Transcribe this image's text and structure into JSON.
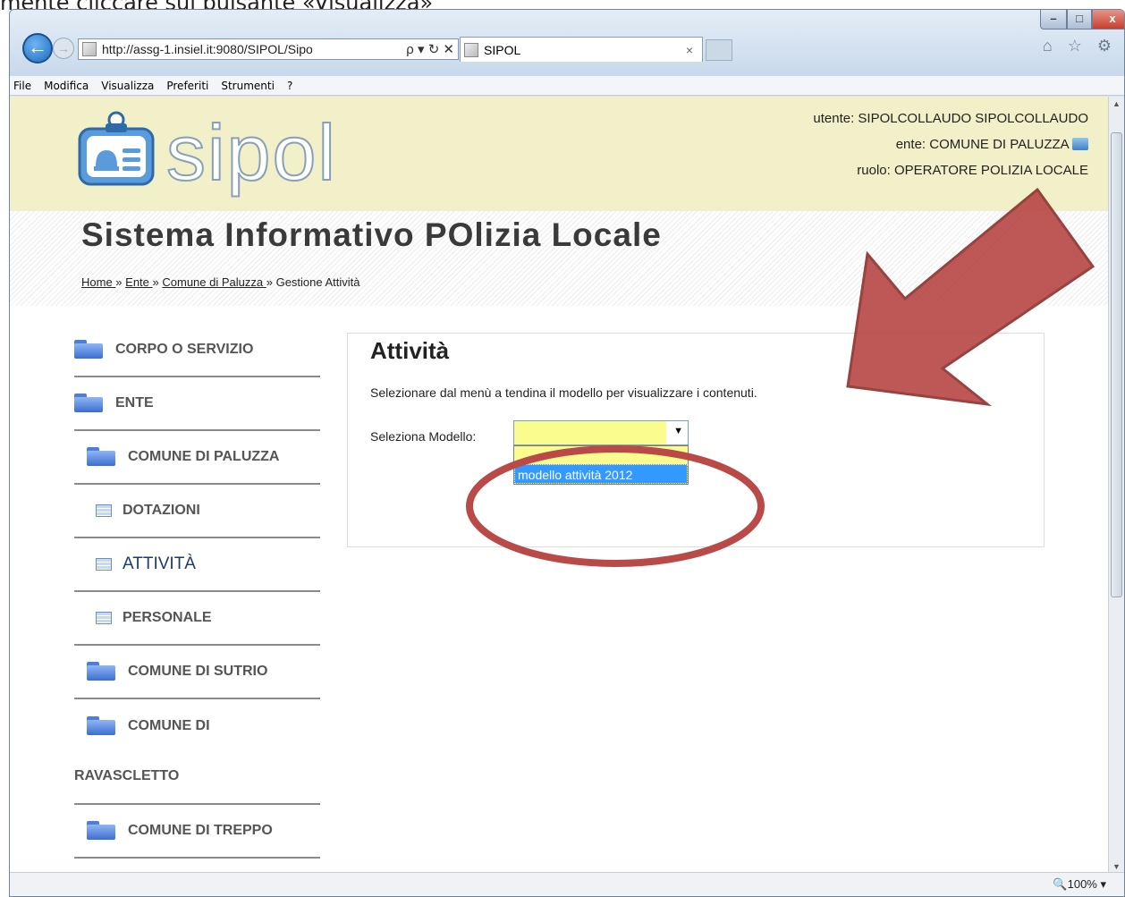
{
  "caption": "mente cliccare sul pulsante «Visualizza»",
  "browser": {
    "url": "http://assg-1.insiel.it:9080/SIPOL/Sipo",
    "tab_title": "SIPOL",
    "tab_close": "×",
    "addr_controls": "ρ ▾ ↻ ✕",
    "toolbar_icons": "⌂ ☆ ⚙",
    "menu": [
      "File",
      "Modifica",
      "Visualizza",
      "Preferiti",
      "Strumenti",
      "?"
    ],
    "window_buttons": {
      "min": "–",
      "max": "□",
      "close": "x"
    },
    "zoom": "100%"
  },
  "header": {
    "logo_text": "sipol",
    "user_line": "utente: SIPOLCOLLAUDO SIPOLCOLLAUDO",
    "ente_line": "ente: COMUNE DI PALUZZA",
    "ruolo_line": "ruolo: OPERATORE POLIZIA LOCALE"
  },
  "page": {
    "system_title": "Sistema Informativo POlizia Locale",
    "breadcrumb": {
      "home": "Home ",
      "sep": "»",
      "ente": "Ente ",
      "comune": "Comune di Paluzza ",
      "current": "Gestione Attività"
    }
  },
  "sidebar": {
    "items": [
      {
        "label": "CORPO O SERVIZIO",
        "icon": "folder-icon"
      },
      {
        "label": "ENTE",
        "icon": "folder-icon"
      },
      {
        "label": "COMUNE DI PALUZZA",
        "icon": "folder-icon"
      },
      {
        "label": "DOTAZIONI",
        "icon": "table-icon"
      },
      {
        "label": "ATTIVITÀ",
        "icon": "table-icon"
      },
      {
        "label": "PERSONALE",
        "icon": "table-icon"
      },
      {
        "label": "COMUNE DI SUTRIO",
        "icon": "folder-icon"
      },
      {
        "label": "COMUNE DI",
        "label2": "RAVASCLETTO",
        "icon": "folder-icon"
      },
      {
        "label": "COMUNE DI TREPPO",
        "icon": "folder-icon"
      }
    ]
  },
  "content": {
    "title": "Attività",
    "description": "Selezionare dal menù a tendina il modello per visualizzare i contenuti.",
    "select_label": "Seleziona Modello:",
    "select_value": "",
    "options": [
      "",
      "modello attività 2012"
    ]
  },
  "colors": {
    "header_bg": "#f1f0c8",
    "select_bg": "#fbfc8e",
    "option_highlight": "#3399ff",
    "annotation_red": "#b94a48"
  }
}
